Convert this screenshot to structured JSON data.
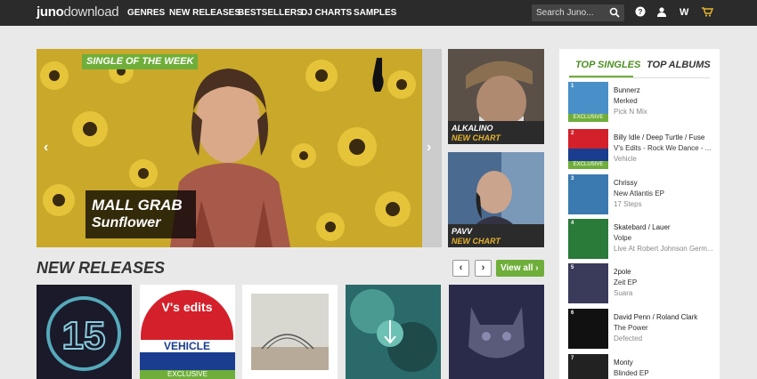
{
  "header": {
    "logo_bold": "juno",
    "logo_light": "download",
    "nav": [
      "GENRES",
      "NEW RELEASES",
      "BESTSELLERS",
      "DJ CHARTS",
      "SAMPLES"
    ],
    "search_placeholder": "Search Juno...",
    "icons": [
      "search-icon",
      "help-icon",
      "user-icon",
      "wishlist-icon",
      "basket-icon"
    ],
    "wishlist_letter": "W"
  },
  "hero": {
    "badge": "SINGLE OF THE WEEK",
    "artist": "MALL GRAB",
    "title": "Sunflower",
    "prev": "‹",
    "next": "›"
  },
  "side_charts": [
    {
      "name": "ALKALINO",
      "sub": "NEW CHART"
    },
    {
      "name": "PAVV",
      "sub": "NEW CHART"
    }
  ],
  "new_releases": {
    "title": "NEW RELEASES",
    "prev": "‹",
    "next": "›",
    "view_all": "View all ›",
    "exclusive": "EXCLUSIVE"
  },
  "panel": {
    "tabs": [
      "TOP SINGLES",
      "TOP ALBUMS"
    ],
    "items": [
      {
        "num": "1",
        "artist": "Bunnerz",
        "title": "Merked",
        "label": "Pick N Mix",
        "exclusive": "EXCLUSIVE"
      },
      {
        "num": "2",
        "artist": "Billy Idle / Deep Turtle / Fuse",
        "title": "V's Edits - Rock We Dance - ...",
        "label": "Vehicle",
        "exclusive": "EXCLUSIVE"
      },
      {
        "num": "3",
        "artist": "Chrissy",
        "title": "New Atlantis EP",
        "label": "17 Steps"
      },
      {
        "num": "4",
        "artist": "Skatebard / Lauer",
        "title": "Volpe",
        "label": "Live At Robert Johnson Germ..."
      },
      {
        "num": "5",
        "artist": "2pole",
        "title": "Zeit EP",
        "label": "Suara"
      },
      {
        "num": "6",
        "artist": "David Penn / Roland Clark",
        "title": "The Power",
        "label": "Defected"
      },
      {
        "num": "7",
        "artist": "Monty",
        "title": "Blinded EP",
        "label": ""
      }
    ]
  },
  "colors": {
    "accent": "#6fae3a",
    "topbar": "#2b2b2b",
    "chart_sub": "#e6b330"
  }
}
